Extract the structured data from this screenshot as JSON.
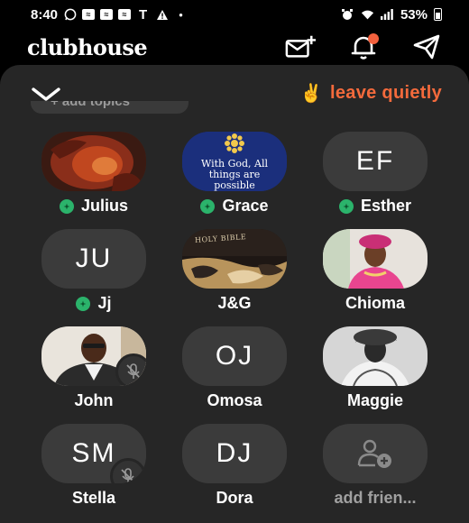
{
  "status_bar": {
    "time": "8:40",
    "battery_percent": "53%",
    "left_icons": [
      "whatsapp-icon",
      "mail-icon",
      "mail-icon",
      "mail-icon",
      "t-mobile-icon",
      "warning-icon",
      "dot-icon"
    ],
    "right_icons": [
      "alarm-icon",
      "wifi-icon",
      "signal-icon",
      "battery-icon"
    ]
  },
  "header": {
    "logo": "clubhouse",
    "actions": [
      "invite-icon",
      "bell-icon",
      "send-icon"
    ],
    "notification_color": "#f3613e"
  },
  "room": {
    "leave_label": "leave quietly",
    "leave_emoji": "✌️",
    "topics_label": "+ add topics",
    "accent_color": "#f46a3c",
    "online_color": "#2bb36b"
  },
  "participants": [
    {
      "name": "Julius",
      "initials": "",
      "online": true,
      "muted": false,
      "photo": "lion"
    },
    {
      "name": "Grace",
      "initials": "",
      "online": true,
      "muted": false,
      "photo": "flower-card",
      "photo_text": "With God, All things are possible"
    },
    {
      "name": "Esther",
      "initials": "EF",
      "online": true,
      "muted": false
    },
    {
      "name": "Jj",
      "initials": "JU",
      "online": true,
      "muted": false
    },
    {
      "name": "J&G",
      "initials": "",
      "online": false,
      "muted": false,
      "photo": "bible",
      "photo_text": "HOLY BIBLE"
    },
    {
      "name": "Chioma",
      "initials": "",
      "online": false,
      "muted": false,
      "photo": "woman-pink"
    },
    {
      "name": "John",
      "initials": "",
      "online": false,
      "muted": true,
      "photo": "man-portrait"
    },
    {
      "name": "Omosa",
      "initials": "OJ",
      "online": false,
      "muted": false
    },
    {
      "name": "Maggie",
      "initials": "",
      "online": false,
      "muted": false,
      "photo": "woman-bw"
    },
    {
      "name": "Stella",
      "initials": "SM",
      "online": false,
      "muted": true
    },
    {
      "name": "Dora",
      "initials": "DJ",
      "online": false,
      "muted": false
    },
    {
      "name": "add frien...",
      "initials": "",
      "online": false,
      "muted": false,
      "icon": "add-user-icon"
    }
  ]
}
